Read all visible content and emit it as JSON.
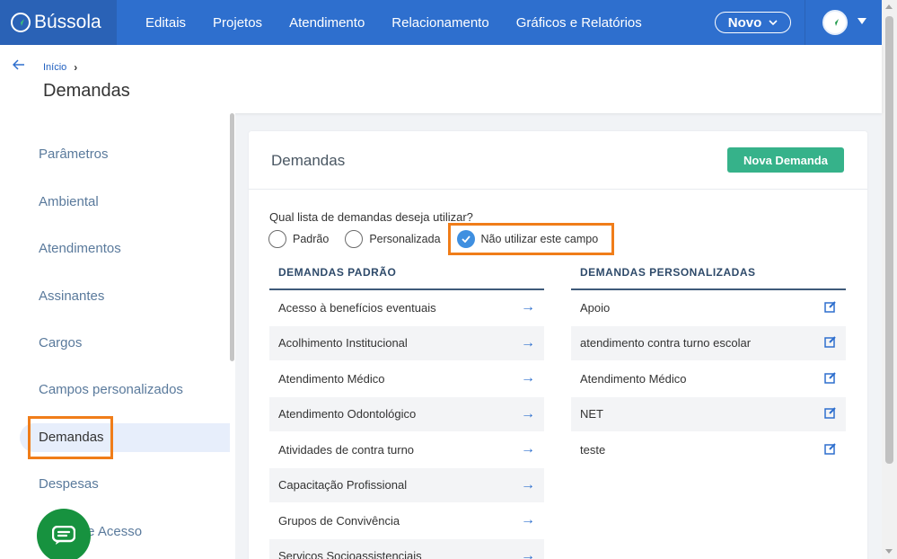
{
  "brand": {
    "name": "Bússola"
  },
  "nav": {
    "items": [
      "Editais",
      "Projetos",
      "Atendimento",
      "Relacionamento",
      "Gráficos e Relatórios"
    ],
    "novo_label": "Novo"
  },
  "header": {
    "breadcrumb": "Início",
    "title": "Demandas"
  },
  "sidebar": {
    "items": [
      "Parâmetros",
      "Ambiental",
      "Atendimentos",
      "Assinantes",
      "Cargos",
      "Campos personalizados",
      "Demandas",
      "Despesas",
      "Níveis de Acesso"
    ],
    "active": "Demandas"
  },
  "card": {
    "title": "Demandas",
    "new_button": "Nova Demanda",
    "question": "Qual lista de demandas deseja utilizar?",
    "options": [
      "Padrão",
      "Personalizada",
      "Não utilizar este campo"
    ],
    "selected_option": "Não utilizar este campo",
    "standard": {
      "header": "DEMANDAS PADRÃO",
      "items": [
        "Acesso à benefícios eventuais",
        "Acolhimento Institucional",
        "Atendimento Médico",
        "Atendimento Odontológico",
        "Atividades de contra turno",
        "Capacitação Profissional",
        "Grupos de Convivência",
        "Serviços Socioassistenciais"
      ]
    },
    "custom": {
      "header": "DEMANDAS PERSONALIZADAS",
      "items": [
        "Apoio",
        "atendimento contra turno escolar",
        "Atendimento Médico",
        "NET",
        "teste"
      ]
    }
  },
  "colors": {
    "nav": "#2e6fce",
    "accent": "#36b28a",
    "highlight": "#f07d19",
    "chat": "#17923f"
  }
}
